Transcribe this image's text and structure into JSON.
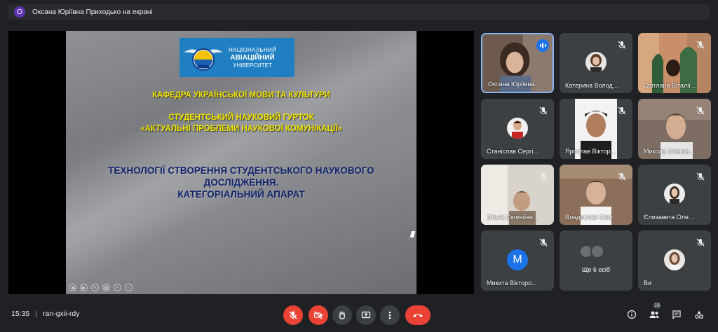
{
  "presenter_bar": {
    "avatar_letter": "О",
    "text": "Оксана Юріївна Приходько на екрані"
  },
  "slide": {
    "logo": {
      "line1": "НАЦІОНАЛЬНИЙ",
      "line2": "АВІАЦІЙНИЙ",
      "line3": "УНІВЕРСИТЕТ"
    },
    "dept": "КАФЕДРА УКРАЇНСЬКОЇ МОВИ ТА КУЛЬТУРИ",
    "circle1": "СТУДЕНТСЬКИЙ НАУКОВИЙ ГУРТОК",
    "circle2": "«АКТУАЛЬНІ ПРОБЛЕМИ НАУКОВОЇ КОМУНІКАЦІЇ»",
    "topic1": "ТЕХНОЛОГІЇ СТВОРЕННЯ СТУДЕНТСЬКОГО НАУКОВОГО",
    "topic2": "ДОСЛІДЖЕННЯ.",
    "topic3": "КАТЕГОРІАЛЬНИЙ АПАРАТ"
  },
  "participants": [
    {
      "name": "Оксана Юріївна...",
      "state": "speaking"
    },
    {
      "name": "Катерина Волод...",
      "state": "muted"
    },
    {
      "name": "Світлана Віталії...",
      "state": "muted"
    },
    {
      "name": "Станіслав Сергі...",
      "state": "muted"
    },
    {
      "name": "Ярослав Віктор...",
      "state": "muted"
    },
    {
      "name": "Микола Олекса...",
      "state": "muted"
    },
    {
      "name": "Ольга Євгеніївн...",
      "state": "muted"
    },
    {
      "name": "Владислав Серг...",
      "state": "muted"
    },
    {
      "name": "Єлизавета Оле...",
      "state": "muted"
    },
    {
      "name": "Микита Вікторо...",
      "state": "muted",
      "avatar_letter": "М"
    },
    {
      "name": "Ще 6 осіб",
      "state": "more"
    },
    {
      "name": "Ви",
      "state": "muted"
    }
  ],
  "bottom": {
    "time": "15:35",
    "separator": "|",
    "meeting_code": "ran-gxii-rdy",
    "people_count": "18"
  },
  "colors": {
    "end_call": "#ea4335",
    "accent": "#8ab4f8",
    "tile_bg": "#3c4043"
  }
}
